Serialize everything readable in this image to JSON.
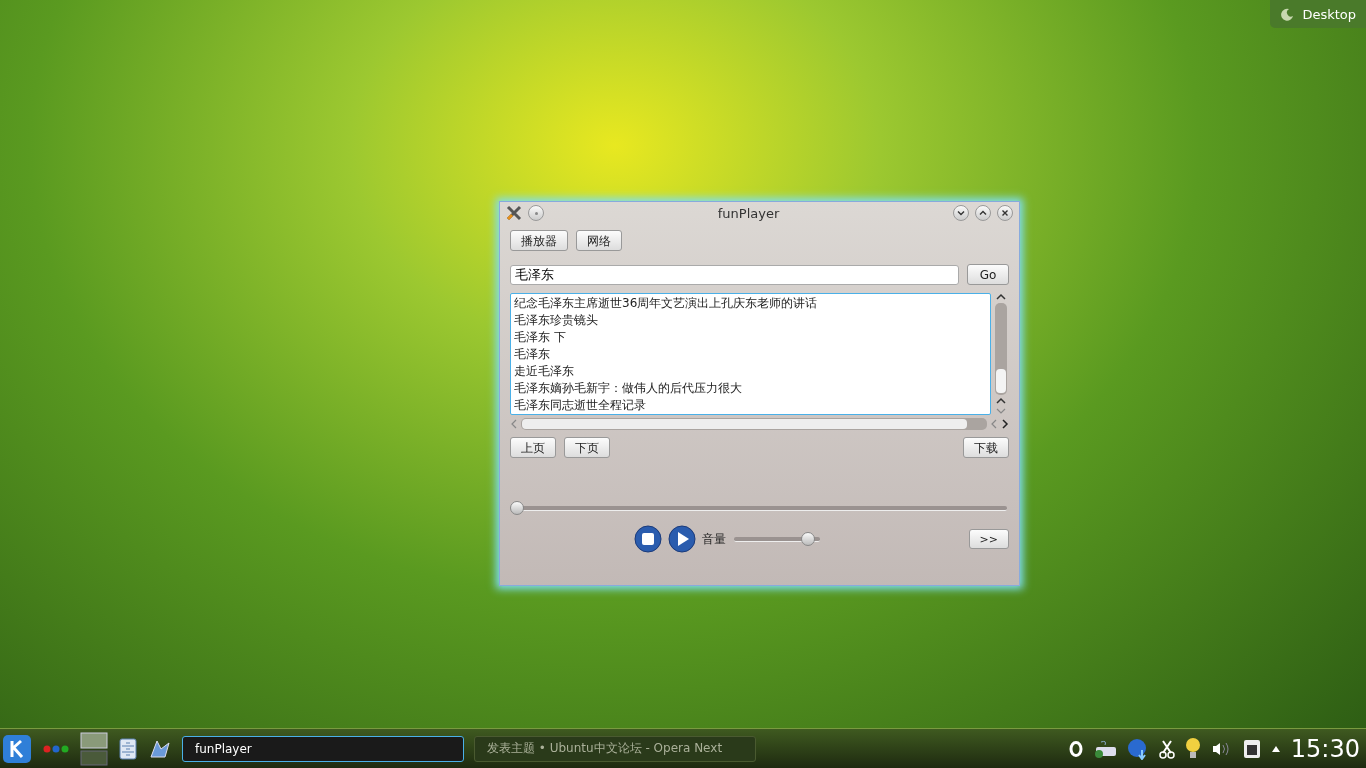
{
  "desktop_button": {
    "label": "Desktop"
  },
  "window": {
    "title": "funPlayer",
    "tabs": [
      {
        "label": "播放器"
      },
      {
        "label": "网络"
      }
    ],
    "search": {
      "value": "毛泽东",
      "button": "Go"
    },
    "results": [
      {
        "text": "纪念毛泽东主席逝世36周年文艺演出上孔庆东老师的讲话"
      },
      {
        "text": "毛泽东珍贵镜头"
      },
      {
        "text": "毛泽东 下"
      },
      {
        "text": "毛泽东"
      },
      {
        "text": "走近毛泽东"
      },
      {
        "text": "毛泽东嫡孙毛新宇：做伟人的后代压力很大"
      },
      {
        "text": "毛泽东同志逝世全程记录"
      }
    ],
    "page_buttons": [
      "上页",
      "下页"
    ],
    "download_button": "下载",
    "seek": {
      "level": 0
    },
    "volume": {
      "label": "音量",
      "level": 0.92
    },
    "more_button": ">>"
  },
  "taskbar": {
    "tasks": [
      {
        "label": "funPlayer",
        "selected": true
      },
      {
        "label": "发表主题 • Ubuntu中文论坛 - Opera Next",
        "selected": false
      }
    ],
    "clock": "15:30"
  }
}
